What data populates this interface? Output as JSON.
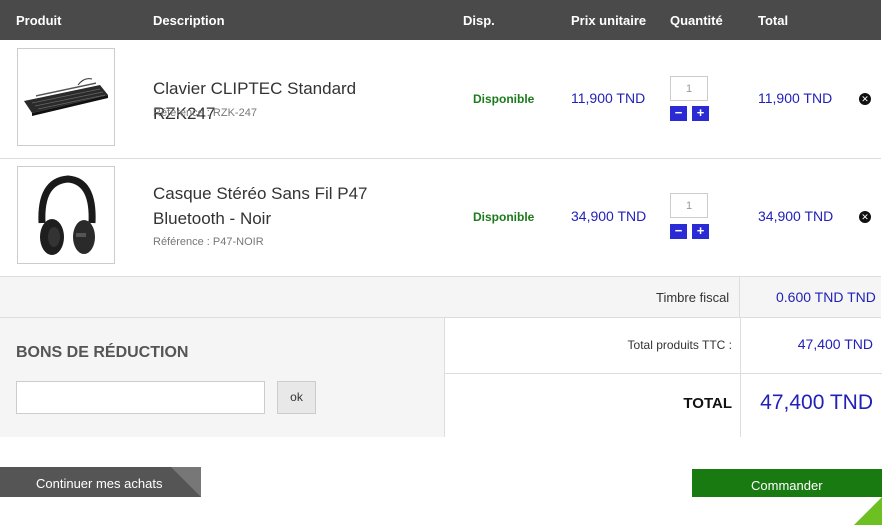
{
  "table_header": {
    "product": "Produit",
    "description": "Description",
    "availability": "Disp.",
    "unit_price": "Prix unitaire",
    "quantity": "Quantité",
    "total": "Total"
  },
  "items": [
    {
      "name": "Clavier CLIPTEC Standard RZK247",
      "reference": "Référence : RZK-247",
      "availability": "Disponible",
      "unit_price": "11,900 TND",
      "quantity": "1",
      "total": "11,900 TND",
      "image_icon": "keyboard-icon"
    },
    {
      "name": "Casque Stéréo Sans Fil P47 Bluetooth - Noir",
      "reference": "Référence : P47-NOIR",
      "availability": "Disponible",
      "unit_price": "34,900 TND",
      "quantity": "1",
      "total": "34,900 TND",
      "image_icon": "headphones-icon"
    }
  ],
  "fiscal": {
    "label": "Timbre fiscal",
    "value": "0.600 TND TND"
  },
  "promo": {
    "title": "BONS DE RÉDUCTION",
    "input_value": "",
    "ok_label": "ok"
  },
  "totals": {
    "products_label": "Total produits TTC :",
    "products_value": "47,400 TND",
    "total_label": "TOTAL",
    "total_value": "47,400 TND"
  },
  "actions": {
    "continue_label": "Continuer mes achats",
    "order_label": "Commander"
  },
  "colors": {
    "header_bg": "#4a4a4a",
    "price": "#2121b8",
    "available": "#1c7b1c",
    "qty_button": "#2b2bd6",
    "order_button": "#1a7a12"
  }
}
